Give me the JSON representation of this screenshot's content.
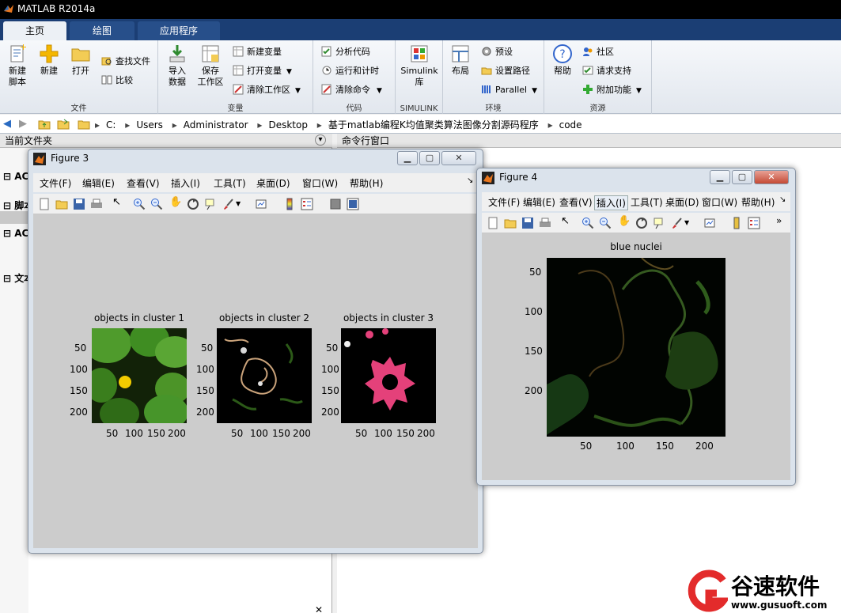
{
  "app": {
    "title": "MATLAB R2014a"
  },
  "ribbon_tabs": [
    {
      "label": "主页"
    },
    {
      "label": "绘图"
    },
    {
      "label": "应用程序"
    }
  ],
  "ribbon": {
    "file": {
      "group_label": "文件",
      "new_script": "新建\n脚本",
      "new": "新建",
      "open": "打开",
      "find_files": "查找文件",
      "compare": "比较"
    },
    "variable": {
      "group_label": "变量",
      "import_data": "导入\n数据",
      "save_workspace": "保存\n工作区",
      "new_variable": "新建变量",
      "open_variable": "打开变量",
      "clear_workspace": "清除工作区"
    },
    "code": {
      "group_label": "代码",
      "analyze_code": "分析代码",
      "run_and_time": "运行和计时",
      "clear_commands": "清除命令"
    },
    "simulink": {
      "group_label": "SIMULINK",
      "simulink_library": "Simulink\n库"
    },
    "environment": {
      "group_label": "环境",
      "layout": "布局",
      "preferences": "预设",
      "set_path": "设置路径",
      "parallel": "Parallel"
    },
    "resources": {
      "group_label": "资源",
      "help": "帮助",
      "community": "社区",
      "request_support": "请求支持",
      "add_ons": "附加功能"
    }
  },
  "address": {
    "crumbs": [
      "C:",
      "Users",
      "Administrator",
      "Desktop",
      "基于matlab编程K均值聚类算法图像分割源码程序",
      "code"
    ]
  },
  "left_panel": {
    "title": "当前文件夹",
    "items": [
      "AC",
      "脚本",
      "AC",
      "文本"
    ]
  },
  "command_window": {
    "title": "命令行窗口"
  },
  "figure3": {
    "title": "Figure 3",
    "menu": [
      "文件(F)",
      "编辑(E)",
      "查看(V)",
      "插入(I)",
      "工具(T)",
      "桌面(D)",
      "窗口(W)",
      "帮助(H)"
    ],
    "axes": [
      {
        "title": "objects in cluster 1"
      },
      {
        "title": "objects in cluster 2"
      },
      {
        "title": "objects in cluster 3"
      }
    ],
    "yticks": [
      "50",
      "100",
      "150",
      "200"
    ],
    "xticks": [
      "50",
      "100",
      "150",
      "200"
    ]
  },
  "figure4": {
    "title": "Figure 4",
    "menu": [
      "文件(F)",
      "编辑(E)",
      "查看(V)",
      "插入(I)",
      "工具(T)",
      "桌面(D)",
      "窗口(W)",
      "帮助(H)"
    ],
    "axes_title": "blue nuclei",
    "yticks": [
      "50",
      "100",
      "150",
      "200"
    ],
    "xticks": [
      "50",
      "100",
      "150",
      "200"
    ]
  },
  "watermark": {
    "brand": "谷速软件",
    "url": "www.gusuoft.com"
  }
}
